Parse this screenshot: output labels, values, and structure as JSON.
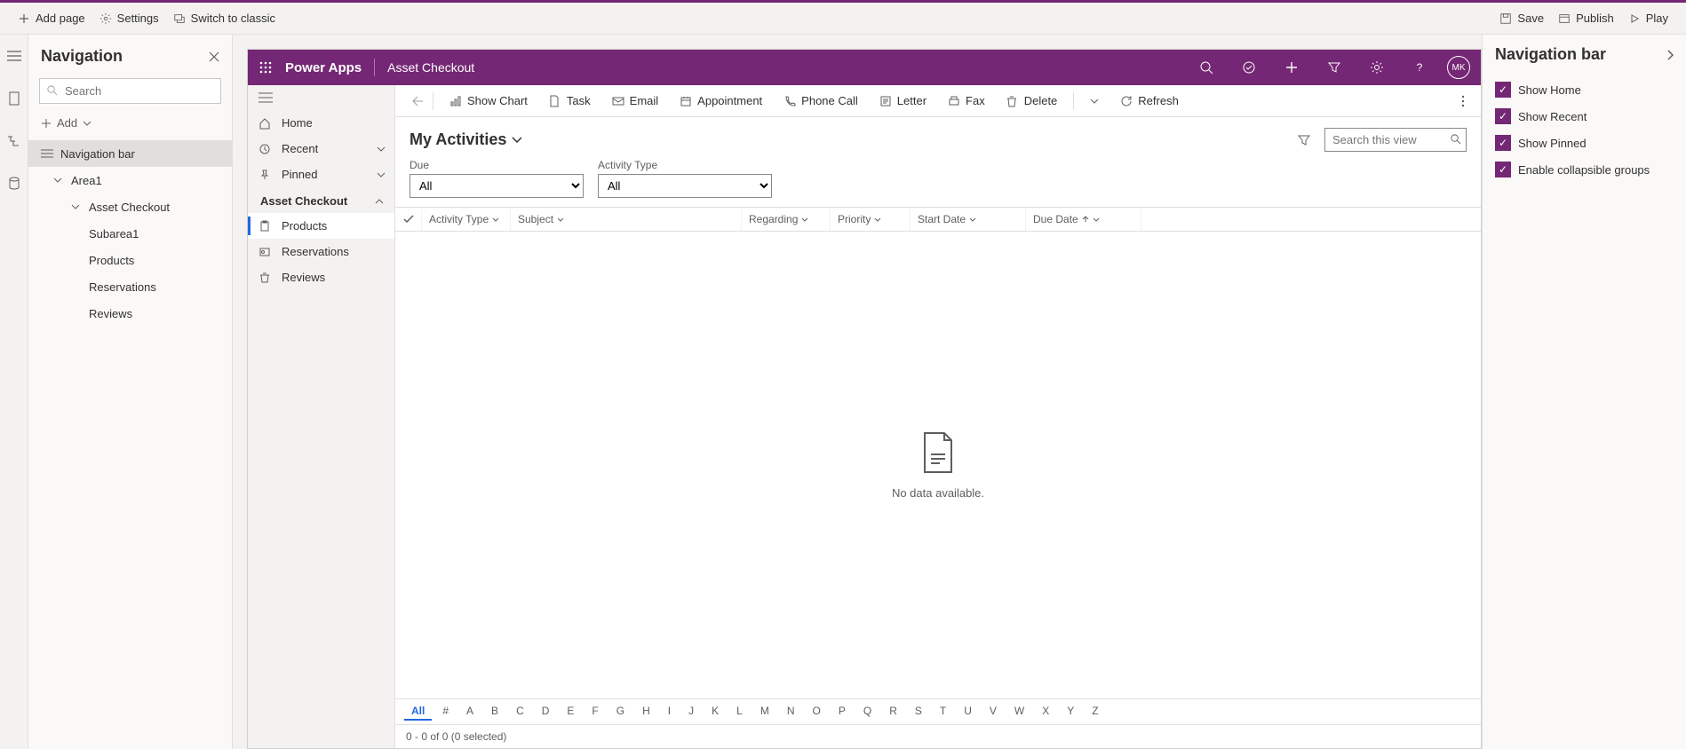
{
  "topToolbar": {
    "addPage": "Add page",
    "settings": "Settings",
    "switchClassic": "Switch to classic",
    "save": "Save",
    "publish": "Publish",
    "play": "Play"
  },
  "navPanel": {
    "title": "Navigation",
    "searchPlaceholder": "Search",
    "add": "Add",
    "items": {
      "navBar": "Navigation bar",
      "area1": "Area1",
      "assetCheckout": "Asset Checkout",
      "subarea1": "Subarea1",
      "products": "Products",
      "reservations": "Reservations",
      "reviews": "Reviews"
    }
  },
  "appHeader": {
    "brand": "Power Apps",
    "appName": "Asset Checkout",
    "avatar": "MK"
  },
  "sideNav": {
    "home": "Home",
    "recent": "Recent",
    "pinned": "Pinned",
    "groupTitle": "Asset Checkout",
    "products": "Products",
    "reservations": "Reservations",
    "reviews": "Reviews"
  },
  "commandBar": {
    "showChart": "Show Chart",
    "task": "Task",
    "email": "Email",
    "appointment": "Appointment",
    "phoneCall": "Phone Call",
    "letter": "Letter",
    "fax": "Fax",
    "delete": "Delete",
    "refresh": "Refresh"
  },
  "view": {
    "title": "My Activities",
    "searchPlaceholder": "Search this view",
    "dueLabel": "Due",
    "dueValue": "All",
    "activityTypeLabel": "Activity Type",
    "activityTypeValue": "All"
  },
  "gridColumns": {
    "activityType": "Activity Type",
    "subject": "Subject",
    "regarding": "Regarding",
    "priority": "Priority",
    "startDate": "Start Date",
    "dueDate": "Due Date"
  },
  "emptyState": "No data available.",
  "alphaBar": [
    "All",
    "#",
    "A",
    "B",
    "C",
    "D",
    "E",
    "F",
    "G",
    "H",
    "I",
    "J",
    "K",
    "L",
    "M",
    "N",
    "O",
    "P",
    "Q",
    "R",
    "S",
    "T",
    "U",
    "V",
    "W",
    "X",
    "Y",
    "Z"
  ],
  "footer": "0 - 0 of 0 (0 selected)",
  "rightPanel": {
    "title": "Navigation bar",
    "showHome": "Show Home",
    "showRecent": "Show Recent",
    "showPinned": "Show Pinned",
    "enableGroups": "Enable collapsible groups"
  }
}
